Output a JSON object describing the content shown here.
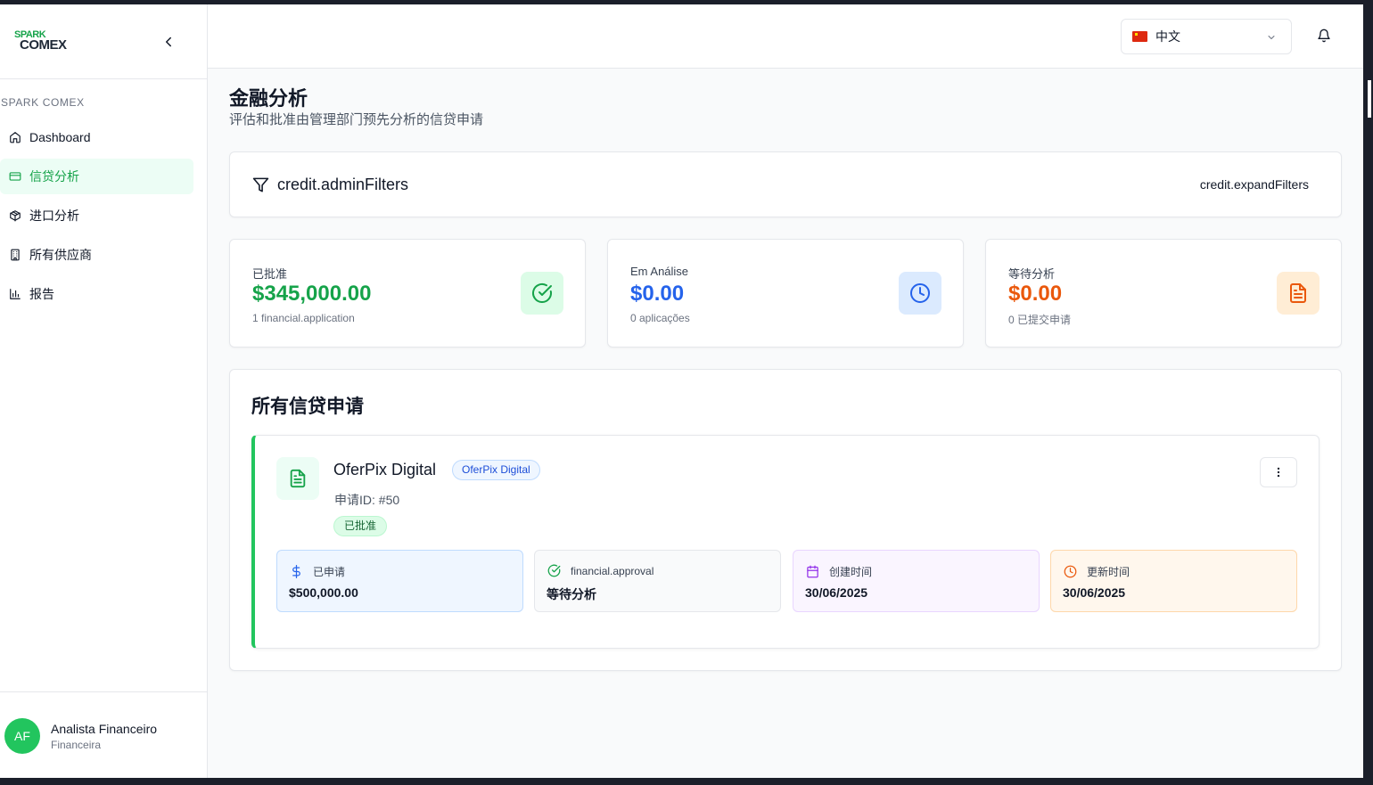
{
  "brand": {
    "logo_line1": "SPARK",
    "logo_line2": "COMEX"
  },
  "sidebar": {
    "section_label": "SPARK COMEX",
    "items": [
      {
        "label": "Dashboard",
        "icon": "home-icon"
      },
      {
        "label": "信贷分析",
        "icon": "credit-card-icon",
        "active": true
      },
      {
        "label": "进口分析",
        "icon": "package-icon"
      },
      {
        "label": "所有供应商",
        "icon": "building-icon"
      },
      {
        "label": "报告",
        "icon": "bar-chart-icon"
      }
    ],
    "user": {
      "initials": "AF",
      "name": "Analista Financeiro",
      "role": "Financeira"
    }
  },
  "header": {
    "language": "中文"
  },
  "page": {
    "title": "金融分析",
    "subtitle": "评估和批准由管理部门预先分析的信贷申请"
  },
  "filters": {
    "title": "credit.adminFilters",
    "expand_label": "credit.expandFilters"
  },
  "stats": [
    {
      "label": "已批准",
      "value": "$345,000.00",
      "sub": "1 financial.application",
      "color": "#16a34a",
      "icon": "check-circle-icon"
    },
    {
      "label": "Em Análise",
      "value": "$0.00",
      "sub": "0 aplicações",
      "color": "#2563eb",
      "icon": "clock-icon"
    },
    {
      "label": "等待分析",
      "value": "$0.00",
      "sub": "0 已提交申请",
      "color": "#ea580c",
      "icon": "file-text-icon"
    }
  ],
  "applications": {
    "title": "所有信贷申请",
    "items": [
      {
        "company": "OferPix Digital",
        "company_badge": "OferPix Digital",
        "id_text": "申请ID: #50",
        "status": "已批准",
        "fields": [
          {
            "label": "已申请",
            "value": "$500,000.00",
            "icon": "dollar-icon"
          },
          {
            "label": "financial.approval",
            "value": "等待分析",
            "icon": "check-circle-icon"
          },
          {
            "label": "创建时间",
            "value": "30/06/2025",
            "icon": "calendar-icon"
          },
          {
            "label": "更新时间",
            "value": "30/06/2025",
            "icon": "clock-icon"
          }
        ]
      }
    ]
  }
}
